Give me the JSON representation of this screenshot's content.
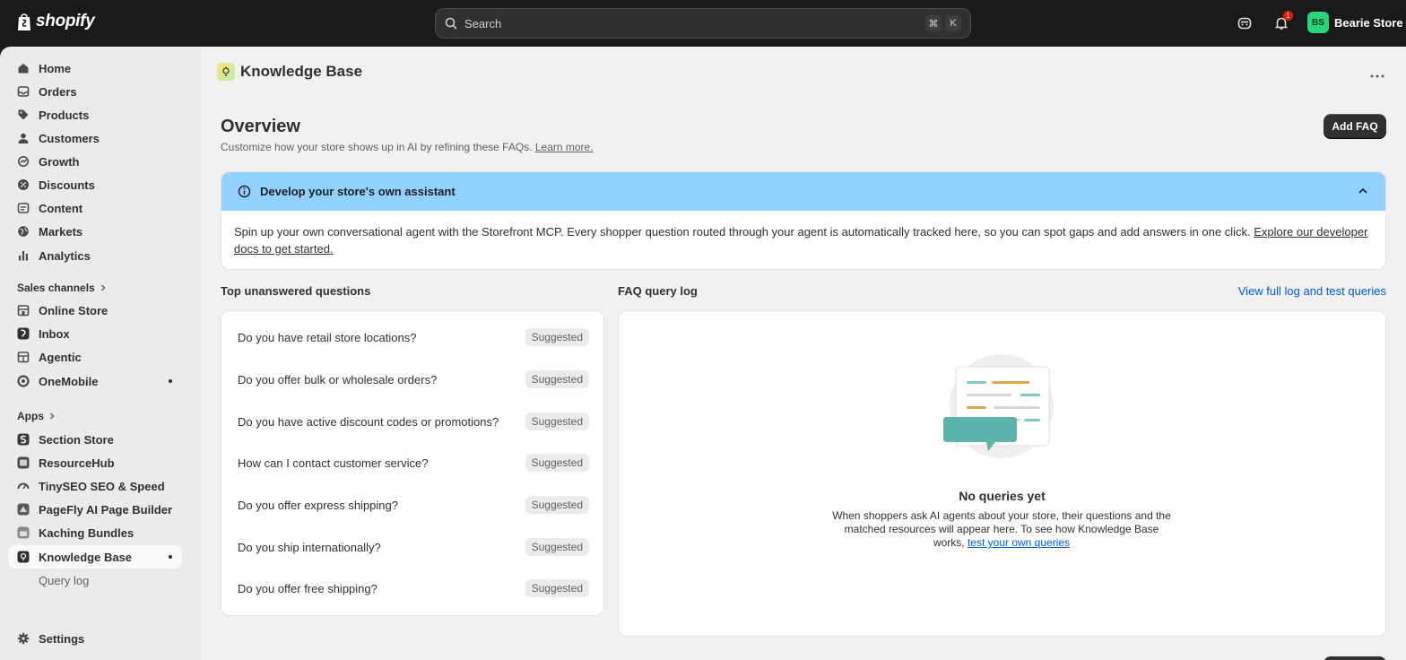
{
  "topbar": {
    "logo_text": "shopify",
    "search_placeholder": "Search",
    "shortcut_cmd": "⌘",
    "shortcut_key": "K",
    "notification_count": "1",
    "store_initials": "BS",
    "store_name": "Bearie Store"
  },
  "sidebar": {
    "items": [
      {
        "label": "Home",
        "icon": "home-icon"
      },
      {
        "label": "Orders",
        "icon": "inbox-tray-icon"
      },
      {
        "label": "Products",
        "icon": "tag-icon"
      },
      {
        "label": "Customers",
        "icon": "person-icon"
      },
      {
        "label": "Growth",
        "icon": "growth-icon"
      },
      {
        "label": "Discounts",
        "icon": "discount-icon"
      },
      {
        "label": "Content",
        "icon": "content-icon"
      },
      {
        "label": "Markets",
        "icon": "globe-icon"
      },
      {
        "label": "Analytics",
        "icon": "bar-chart-icon"
      }
    ],
    "sales_channels_label": "Sales channels",
    "channels": [
      {
        "label": "Online Store"
      },
      {
        "label": "Inbox"
      },
      {
        "label": "Agentic"
      },
      {
        "label": "OneMobile"
      }
    ],
    "apps_label": "Apps",
    "apps": [
      {
        "label": "Section Store"
      },
      {
        "label": "ResourceHub"
      },
      {
        "label": "TinySEO SEO & Speed"
      },
      {
        "label": "PageFly AI Page Builder"
      },
      {
        "label": "Kaching Bundles"
      },
      {
        "label": "Knowledge Base"
      }
    ],
    "sub_item": "Query log",
    "settings_label": "Settings"
  },
  "page": {
    "title": "Knowledge Base",
    "overview_title": "Overview",
    "overview_sub": "Customize how your store shows up in AI by refining these FAQs.",
    "learn_more": "Learn more.",
    "add_faq": "Add FAQ"
  },
  "banner": {
    "title": "Develop your store's own assistant",
    "body": "Spin up your own conversational agent with the Storefront MCP. Every shopper question routed through your agent is automatically tracked here, so you can spot gaps and add answers in one click.",
    "link": "Explore our developer docs to get started."
  },
  "questions": {
    "title": "Top unanswered questions",
    "items": [
      {
        "text": "Do you have retail store locations?",
        "badge": "Suggested"
      },
      {
        "text": "Do you offer bulk or wholesale orders?",
        "badge": "Suggested"
      },
      {
        "text": "Do you have active discount codes or promotions?",
        "badge": "Suggested"
      },
      {
        "text": "How can I contact customer service?",
        "badge": "Suggested"
      },
      {
        "text": "Do you offer express shipping?",
        "badge": "Suggested"
      },
      {
        "text": "Do you ship internationally?",
        "badge": "Suggested"
      },
      {
        "text": "Do you offer free shipping?",
        "badge": "Suggested"
      }
    ]
  },
  "query_log": {
    "title": "FAQ query log",
    "view_link": "View full log and test queries",
    "empty_title": "No queries yet",
    "empty_desc": "When shoppers ask AI agents about your store, their questions and the matched resources will appear here. To see how Knowledge Base works,",
    "empty_link": "test your own queries"
  },
  "colors": {
    "accent_link": "#005bd3",
    "banner_bg": "#91d0ff",
    "primary_button": "#303030",
    "avatar_bg": "#29d47c",
    "notification_badge": "#e51c00"
  }
}
